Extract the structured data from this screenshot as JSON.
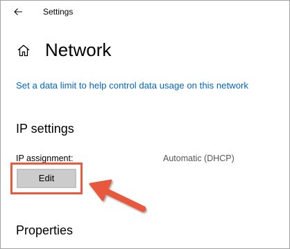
{
  "window": {
    "title": "Settings"
  },
  "icons": {
    "back": "back-arrow-icon",
    "home": "home-icon"
  },
  "page": {
    "title": "Network",
    "data_limit_link": "Set a data limit to help control data usage on this network"
  },
  "ip_settings": {
    "heading": "IP settings",
    "assignment_label": "IP assignment:",
    "assignment_value": "Automatic (DHCP)",
    "edit_button_label": "Edit"
  },
  "properties": {
    "heading": "Properties"
  },
  "colors": {
    "link": "#0067c0",
    "highlight": "#e8593e",
    "button_bg": "#cccccc"
  }
}
